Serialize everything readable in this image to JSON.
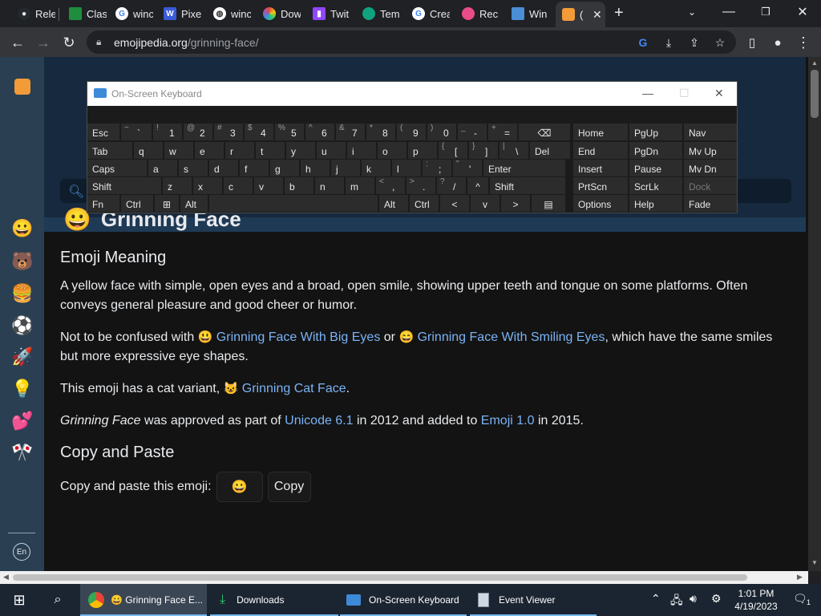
{
  "browser": {
    "tabs": [
      {
        "label": "Rele",
        "icon": "github-icon",
        "color": "#24292e"
      },
      {
        "label": "Clas",
        "icon": "page-icon",
        "color": "#1e8e3e"
      },
      {
        "label": "winc",
        "icon": "google-icon",
        "color": "#ffffff"
      },
      {
        "label": "Pixe",
        "icon": "w-icon",
        "color": "#3a5bd9"
      },
      {
        "label": "winc",
        "icon": "globe-icon",
        "color": "#ffffff"
      },
      {
        "label": "Dow",
        "icon": "colorwheel-icon",
        "color": "#e84c3d"
      },
      {
        "label": "Twit",
        "icon": "twitch-icon",
        "color": "#9146ff"
      },
      {
        "label": "Tem",
        "icon": "circle-icon",
        "color": "#10a37f"
      },
      {
        "label": "Crea",
        "icon": "google-icon",
        "color": "#ffffff"
      },
      {
        "label": "Rec",
        "icon": "dribbble-icon",
        "color": "#ea4c89"
      },
      {
        "label": "Win",
        "icon": "windows-icon",
        "color": "#4a8ed6"
      },
      {
        "label": "(",
        "icon": "emojipedia-icon",
        "color": "#f29b38"
      }
    ],
    "new_tab": "+",
    "url_domain": "emojipedia.org",
    "url_path": "/grinning-face/"
  },
  "sidebar": {
    "icons": [
      "😀",
      "🐻",
      "🍔",
      "⚽",
      "🚀",
      "💡",
      "💕",
      "🎌"
    ],
    "lang": "En"
  },
  "osk": {
    "title": "On-Screen Keyboard",
    "keys": [
      [
        "Esc",
        "",
        "1",
        "!",
        "2",
        "@",
        "3",
        "#",
        "4",
        "$",
        "5",
        "%",
        "6",
        "^",
        "7",
        "&",
        "8",
        "*",
        "9",
        "(",
        "0",
        ")",
        "-",
        "_",
        "=",
        "+",
        "⌫",
        "",
        "Home",
        "",
        "PgUp",
        "",
        "Nav",
        ""
      ],
      [
        "Tab",
        "q",
        "w",
        "e",
        "r",
        "t",
        "y",
        "u",
        "i",
        "o",
        "p",
        "[",
        "{",
        "]",
        "}",
        "\\",
        "|",
        "Del",
        "End",
        "PgDn",
        "Mv Up"
      ],
      [
        "Caps",
        "a",
        "s",
        "d",
        "f",
        "g",
        "h",
        "j",
        "k",
        "l",
        ";",
        ":",
        "'",
        "\"",
        "Enter",
        "Insert",
        "Pause",
        "Mv Dn"
      ],
      [
        "Shift",
        "z",
        "x",
        "c",
        "v",
        "b",
        "n",
        "m",
        ",",
        "<",
        ".",
        ">",
        "/",
        "?",
        "^",
        "Shift",
        "PrtScn",
        "ScrLk",
        "Dock"
      ],
      [
        "Fn",
        "Ctrl",
        "⊞",
        "Alt",
        "Alt",
        "Ctrl",
        "<",
        "v",
        ">",
        "▤",
        "Options",
        "Help",
        "Fade"
      ]
    ]
  },
  "page": {
    "title": "Grinning Face",
    "title_emoji": "😀",
    "h_meaning": "Emoji Meaning",
    "p1": "A yellow face with simple, open eyes and a broad, open smile, showing upper teeth and tongue on some platforms. Often conveys general pleasure and good cheer or humor.",
    "p2_pre": "Not to be confused with ",
    "p2_e1": "😃",
    "p2_link1": "Grinning Face With Big Eyes",
    "p2_or": " or ",
    "p2_e2": "😄",
    "p2_link2": "Grinning Face With Smiling Eyes",
    "p2_post": ", which have the same smiles but more expressive eye shapes.",
    "p3_pre": "This emoji has a cat variant, ",
    "p3_e": "😺",
    "p3_link": "Grinning Cat Face",
    "p3_post": ".",
    "p4_em": "Grinning Face",
    "p4_a": " was approved as part of ",
    "p4_link1": "Unicode 6.1",
    "p4_b": " in 2012 and added to ",
    "p4_link2": "Emoji 1.0",
    "p4_c": " in 2015.",
    "h_copy": "Copy and Paste",
    "copy_label": "Copy and paste this emoji:",
    "copy_emoji": "😀",
    "copy_button": "Copy"
  },
  "taskbar": {
    "items": [
      {
        "label": "😀 Grinning Face E...",
        "icon": "chrome-icon"
      },
      {
        "label": "Downloads",
        "icon": "download-icon"
      },
      {
        "label": "On-Screen Keyboard",
        "icon": "keyboard-icon"
      },
      {
        "label": "Event Viewer",
        "icon": "event-viewer-icon"
      }
    ],
    "time": "1:01 PM",
    "date": "4/19/2023",
    "notif_count": "1"
  }
}
